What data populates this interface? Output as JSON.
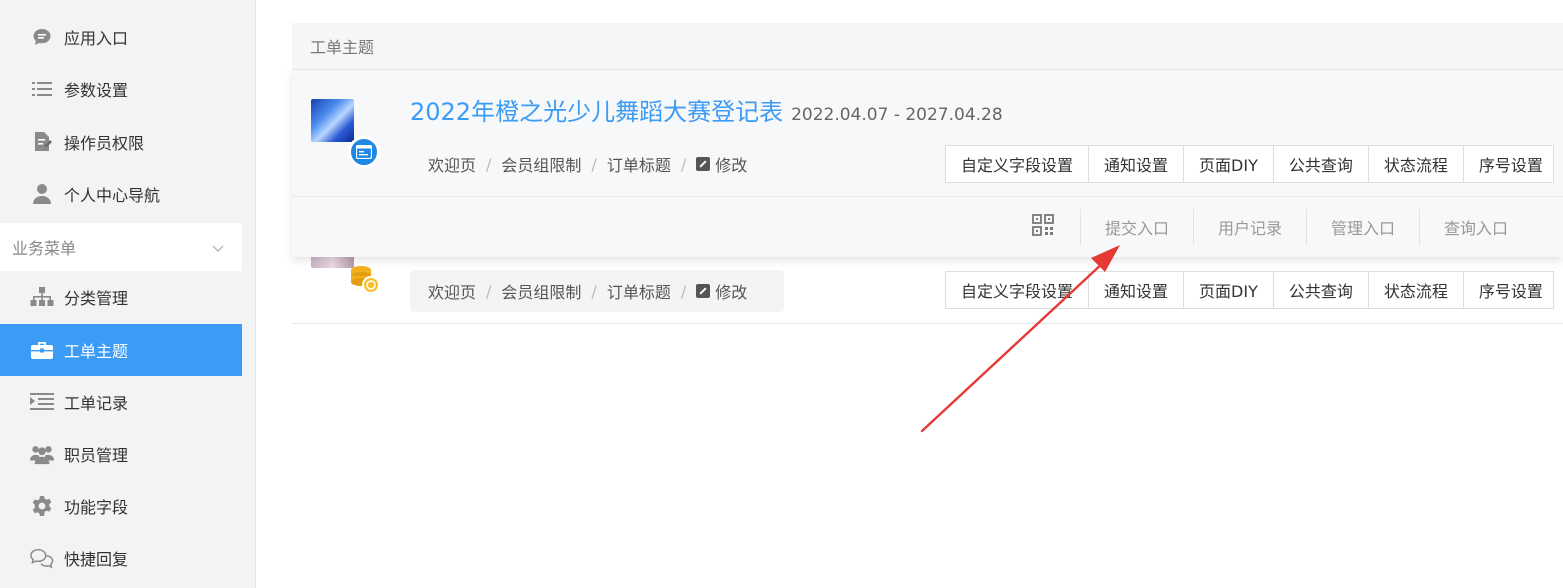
{
  "sidebar": {
    "items_top": [
      {
        "label": "应用入口",
        "icon": "chat-bubble-icon"
      },
      {
        "label": "参数设置",
        "icon": "list-settings-icon"
      },
      {
        "label": "操作员权限",
        "icon": "document-edit-icon"
      },
      {
        "label": "个人中心导航",
        "icon": "user-icon"
      }
    ],
    "group_label": "业务菜单",
    "items_group": [
      {
        "label": "分类管理",
        "icon": "sitemap-icon"
      },
      {
        "label": "工单主题",
        "icon": "briefcase-icon",
        "active": true
      },
      {
        "label": "工单记录",
        "icon": "list-indent-icon"
      },
      {
        "label": "职员管理",
        "icon": "users-icon"
      },
      {
        "label": "功能字段",
        "icon": "gear-icon"
      },
      {
        "label": "快捷回复",
        "icon": "chat-bubbles-icon"
      }
    ]
  },
  "panel": {
    "header": "工单主题",
    "rows": [
      {
        "title": "2022年橙之光少儿舞蹈大赛登记表",
        "date_range": "2022.04.07 - 2027.04.28",
        "crumbs": [
          "欢迎页",
          "会员组限制",
          "订单标题"
        ],
        "edit_label": "修改",
        "buttons": [
          "自定义字段设置",
          "通知设置",
          "页面DIY",
          "公共查询",
          "状态流程",
          "序号设置"
        ],
        "entries": [
          "提交入口",
          "用户记录",
          "管理入口",
          "查询入口"
        ]
      },
      {
        "crumbs": [
          "欢迎页",
          "会员组限制",
          "订单标题"
        ],
        "edit_label": "修改",
        "buttons": [
          "自定义字段设置",
          "通知设置",
          "页面DIY",
          "公共查询",
          "状态流程",
          "序号设置"
        ]
      }
    ]
  },
  "colors": {
    "accent": "#3b9bf5",
    "sidebar_bg": "#f2f3f5",
    "arrow": "#e53935"
  }
}
